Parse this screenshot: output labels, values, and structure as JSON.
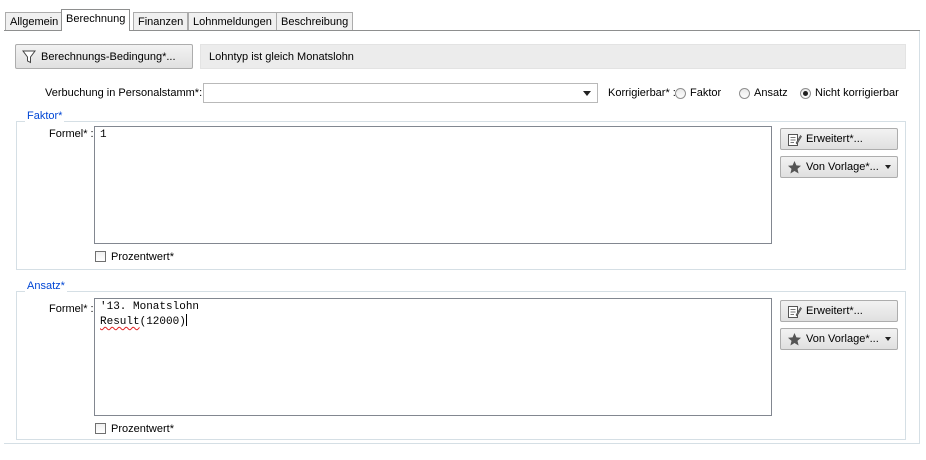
{
  "tabs": [
    {
      "label": "Allgemein",
      "active": false
    },
    {
      "label": "Berechnung",
      "active": true
    },
    {
      "label": "Finanzen",
      "active": false
    },
    {
      "label": "Lohnmeldungen",
      "active": false
    },
    {
      "label": "Beschreibung",
      "active": false
    }
  ],
  "condition": {
    "button_label": "Berechnungs-Bedingung*...",
    "button_icon": "filter-icon",
    "text": "Lohntyp ist gleich Monatslohn"
  },
  "posting": {
    "label": "Verbuchung in Personalstamm*:",
    "value": "",
    "correctable_label": "Korrigierbar* :",
    "options": [
      {
        "label": "Faktor",
        "selected": false
      },
      {
        "label": "Ansatz",
        "selected": false
      },
      {
        "label": "Nicht korrigierbar",
        "selected": true
      }
    ]
  },
  "factor": {
    "title": "Faktor*",
    "formula_label": "Formel* :",
    "formula_value": "1",
    "advanced_button": "Erweitert*...",
    "template_button": "Von Vorlage*...",
    "percent_label": "Prozentwert*",
    "percent_checked": false
  },
  "rate": {
    "title": "Ansatz*",
    "formula_label": "Formel* :",
    "formula_line1": "'13. Monatslohn",
    "formula_line2_fn": "Result",
    "formula_line2_args": "(12000)",
    "advanced_button": "Erweitert*...",
    "template_button": "Von Vorlage*...",
    "percent_label": "Prozentwert*",
    "percent_checked": false
  },
  "icons": {
    "advanced": "pencil-document-icon",
    "template": "star-icon",
    "dropdown": "chevron-down-icon"
  }
}
